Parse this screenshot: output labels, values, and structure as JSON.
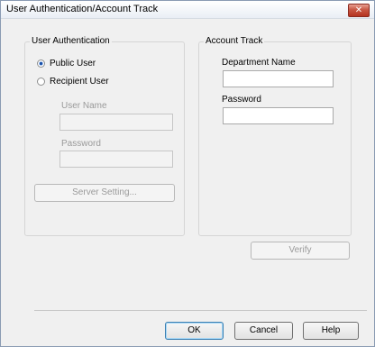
{
  "window": {
    "title": "User Authentication/Account Track",
    "close_glyph": "✕"
  },
  "user_auth": {
    "group_title": "User Authentication",
    "public_user": "Public User",
    "recipient_user": "Recipient User",
    "selected": "Public User",
    "user_name_label": "User Name",
    "user_name_value": "",
    "password_label": "Password",
    "password_value": "",
    "server_setting_button": "Server Setting..."
  },
  "account_track": {
    "group_title": "Account Track",
    "department_name_label": "Department Name",
    "department_name_value": "",
    "password_label": "Password",
    "password_value": ""
  },
  "verify_button": "Verify",
  "footer": {
    "ok": "OK",
    "cancel": "Cancel",
    "help": "Help"
  }
}
